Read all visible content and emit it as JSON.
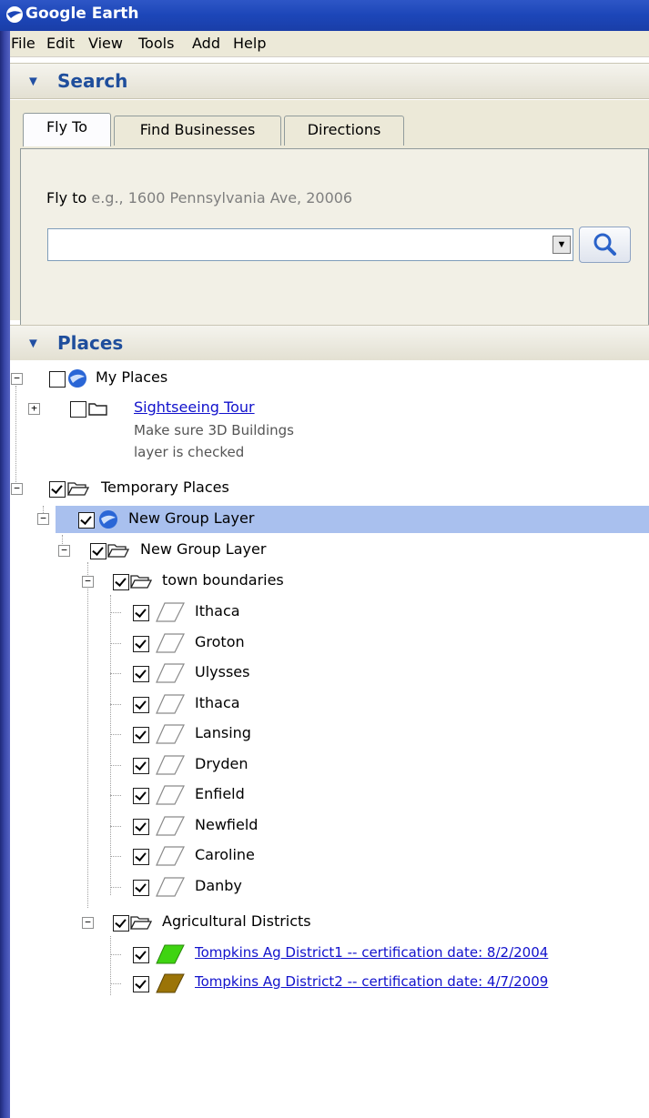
{
  "window": {
    "title": "Google Earth"
  },
  "menu": [
    "File",
    "Edit",
    "View",
    "Tools",
    "Add",
    "Help"
  ],
  "search": {
    "header": "Search",
    "tabs": [
      "Fly To",
      "Find Businesses",
      "Directions"
    ],
    "active_tab": "Fly To",
    "label": "Fly to",
    "hint": "e.g., 1600 Pennsylvania Ave, 20006",
    "value": ""
  },
  "places": {
    "header": "Places",
    "my_places": "My Places",
    "sightseeing": "Sightseeing Tour",
    "sightseeing_desc_1": "Make sure 3D Buildings",
    "sightseeing_desc_2": "layer is checked",
    "temporary": "Temporary Places",
    "group1": "New Group Layer",
    "group2": "New Group Layer",
    "towns_folder": "town boundaries",
    "towns": [
      "Ithaca",
      "Groton",
      "Ulysses",
      "Ithaca",
      "Lansing",
      "Dryden",
      "Enfield",
      "Newfield",
      "Caroline",
      "Danby"
    ],
    "ag_folder": "Agricultural Districts",
    "ag_items": [
      "Tompkins Ag District1 -- certification date: 8/2/2004",
      "Tompkins Ag District2 -- certification date: 4/7/2009"
    ]
  },
  "colors": {
    "title_bar": "#1c46b8",
    "selection": "#a9c0ee",
    "ag1_fill": "#3fd411",
    "ag2_fill": "#9b7407",
    "link": "#1111cc"
  }
}
